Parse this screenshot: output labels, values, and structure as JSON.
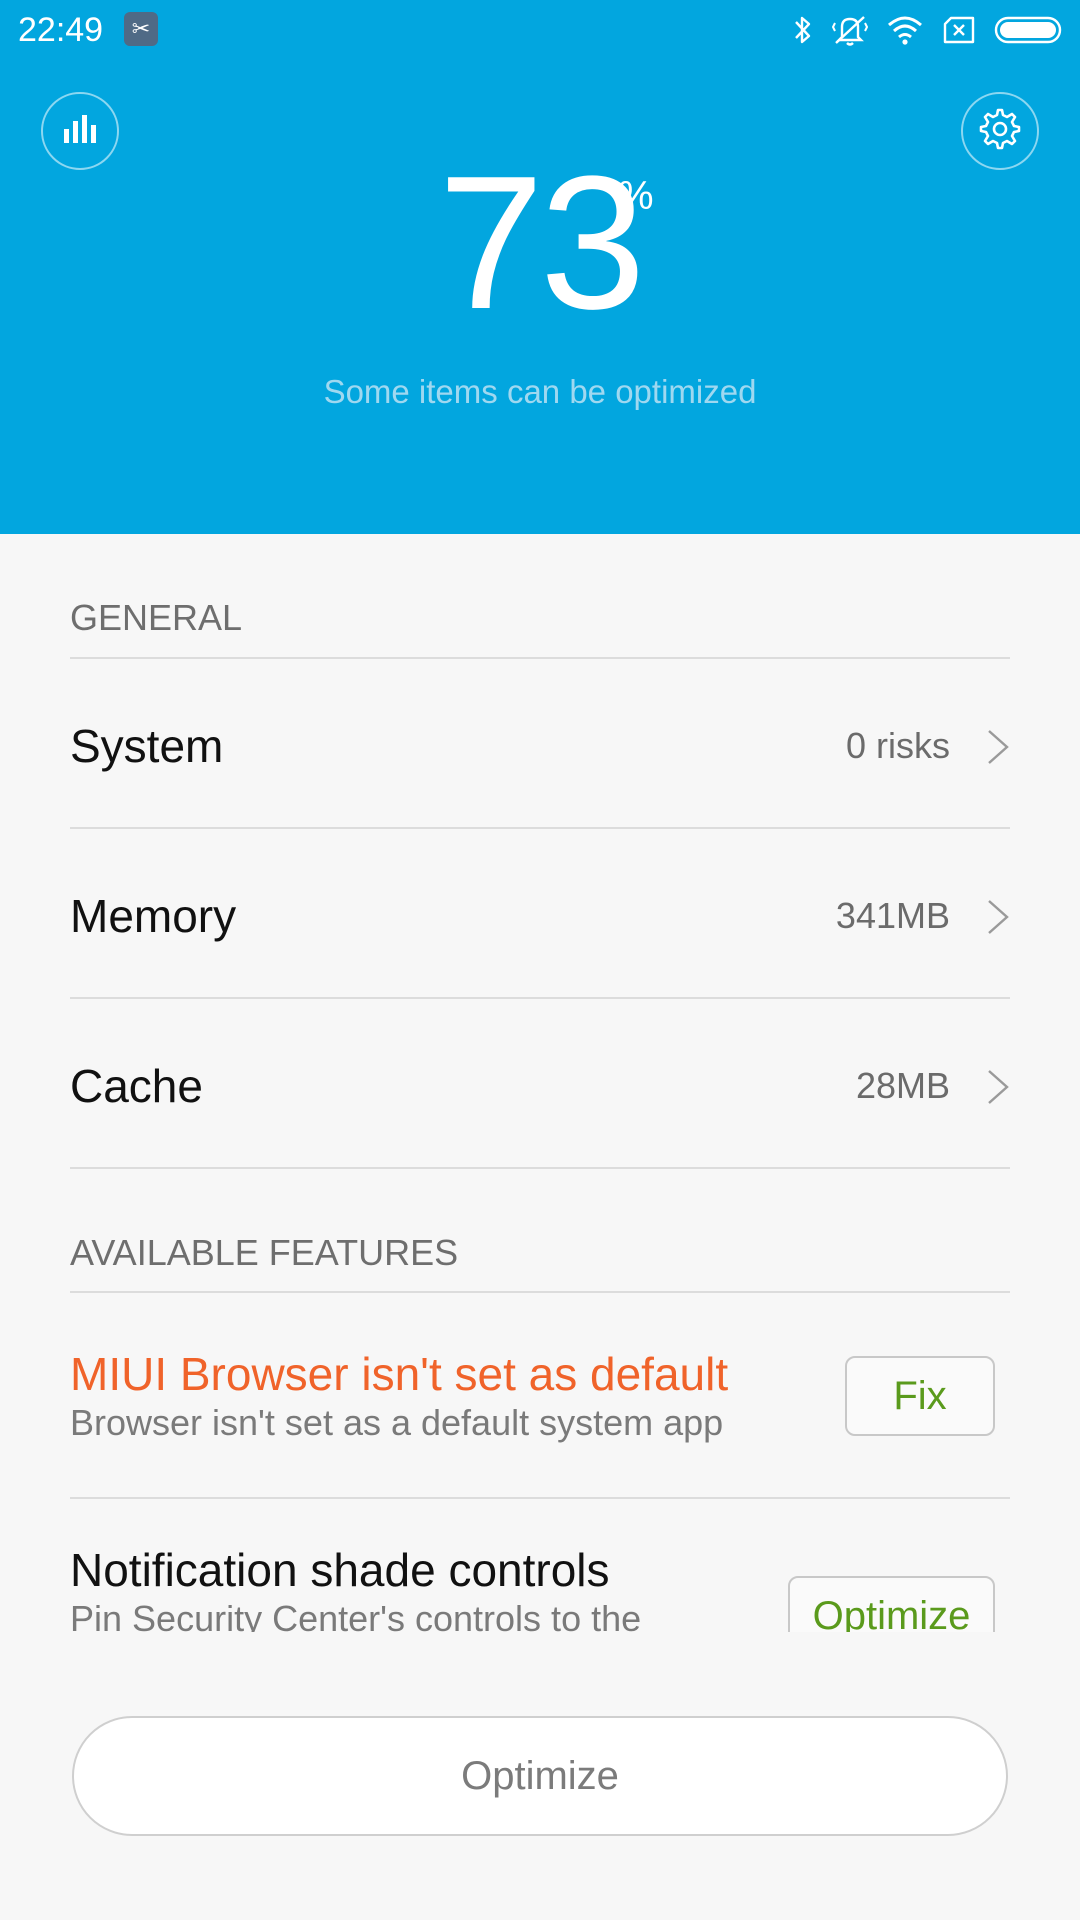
{
  "status_bar": {
    "time": "22:49",
    "icons": [
      "app-notification-icon",
      "bluetooth-icon",
      "vibrate-icon",
      "wifi-icon",
      "no-sim-icon",
      "battery-icon"
    ]
  },
  "header": {
    "score": "73",
    "score_unit": "%",
    "caption": "Some items can be optimized",
    "background_color": "#02a6df"
  },
  "general": {
    "title": "GENERAL",
    "items": [
      {
        "label": "System",
        "value": "0 risks"
      },
      {
        "label": "Memory",
        "value": "341MB"
      },
      {
        "label": "Cache",
        "value": "28MB"
      }
    ]
  },
  "features": {
    "title": "AVAILABLE FEATURES",
    "items": [
      {
        "title": "MIUI Browser isn't set as default",
        "description": "Browser isn't set as a default system app",
        "action": "Fix",
        "title_color": "#f0632a"
      },
      {
        "title": "Notification shade controls",
        "description": "Pin Security Center's controls to the",
        "action": "Optimize"
      }
    ]
  },
  "footer": {
    "optimize_label": "Optimize"
  }
}
